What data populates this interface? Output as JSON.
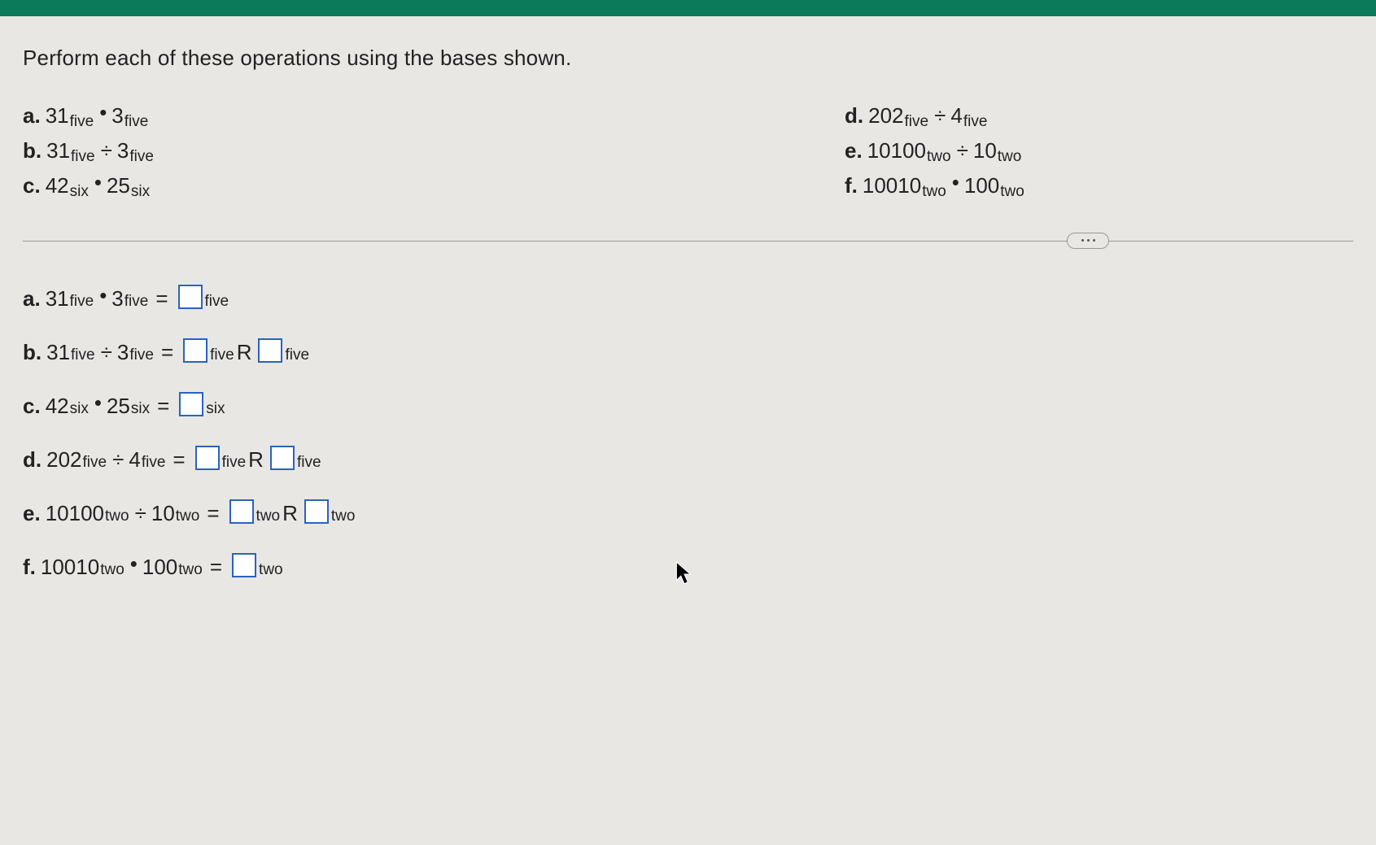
{
  "instruction": "Perform each of these operations using the bases shown.",
  "problems_left": [
    {
      "label": "a.",
      "a_num": "31",
      "a_base": "five",
      "op": "dot",
      "b_num": "3",
      "b_base": "five"
    },
    {
      "label": "b.",
      "a_num": "31",
      "a_base": "five",
      "op": "div",
      "b_num": "3",
      "b_base": "five"
    },
    {
      "label": "c.",
      "a_num": "42",
      "a_base": "six",
      "op": "dot",
      "b_num": "25",
      "b_base": "six"
    }
  ],
  "problems_right": [
    {
      "label": "d.",
      "a_num": "202",
      "a_base": "five",
      "op": "div",
      "b_num": "4",
      "b_base": "five"
    },
    {
      "label": "e.",
      "a_num": "10100",
      "a_base": "two",
      "op": "div",
      "b_num": "10",
      "b_base": "two"
    },
    {
      "label": "f.",
      "a_num": "10010",
      "a_base": "two",
      "op": "dot",
      "b_num": "100",
      "b_base": "two"
    }
  ],
  "answers": [
    {
      "label": "a.",
      "a_num": "31",
      "a_base": "five",
      "op": "dot",
      "b_num": "3",
      "b_base": "five",
      "eq": "=",
      "ans1_base": "five",
      "has_r": false
    },
    {
      "label": "b.",
      "a_num": "31",
      "a_base": "five",
      "op": "div",
      "b_num": "3",
      "b_base": "five",
      "eq": "=",
      "ans1_base": "five",
      "has_r": true,
      "r": "R",
      "ans2_base": "five"
    },
    {
      "label": "c.",
      "a_num": "42",
      "a_base": "six",
      "op": "dot",
      "b_num": "25",
      "b_base": "six",
      "eq": "=",
      "ans1_base": "six",
      "has_r": false
    },
    {
      "label": "d.",
      "a_num": "202",
      "a_base": "five",
      "op": "div",
      "b_num": "4",
      "b_base": "five",
      "eq": "=",
      "ans1_base": "five",
      "has_r": true,
      "r": "R",
      "ans2_base": "five"
    },
    {
      "label": "e.",
      "a_num": "10100",
      "a_base": "two",
      "op": "div",
      "b_num": "10",
      "b_base": "two",
      "eq": "=",
      "ans1_base": "two",
      "has_r": true,
      "r": "R",
      "ans2_base": "two"
    },
    {
      "label": "f.",
      "a_num": "10010",
      "a_base": "two",
      "op": "dot",
      "b_num": "100",
      "b_base": "two",
      "eq": "=",
      "ans1_base": "two",
      "has_r": false
    }
  ],
  "symbols": {
    "dot": "•",
    "div": "÷"
  }
}
